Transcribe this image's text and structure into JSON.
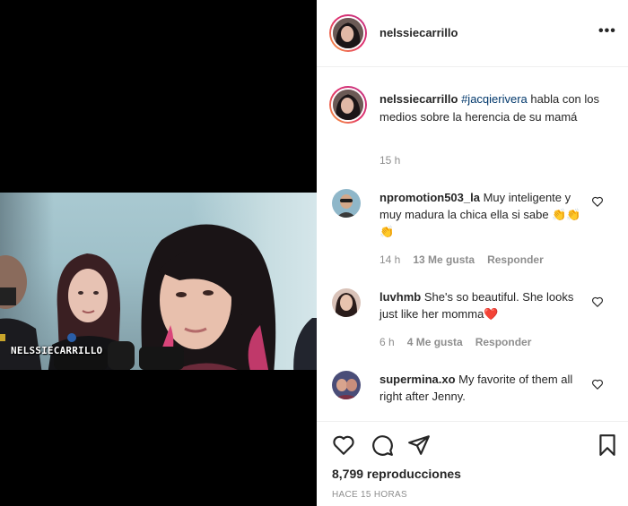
{
  "media": {
    "watermark": "NELSSIECARRILLO"
  },
  "header": {
    "username": "nelssiecarrillo",
    "more_icon": "more-horizontal-icon"
  },
  "caption": {
    "username": "nelssiecarrillo",
    "hashtag": "#jacqierivera",
    "text": " habla con los medios sobre la herencia de su mamá",
    "time": "15 h"
  },
  "comments": [
    {
      "username": "npromotion503_la",
      "text": " Muy inteligente y muy madura la chica ella si sabe 👏👏👏",
      "time": "14 h",
      "likes": "13 Me gusta",
      "reply": "Responder"
    },
    {
      "username": "luvhmb",
      "text": " She's so beautiful. She looks just like her momma❤️",
      "time": "6 h",
      "likes": "4 Me gusta",
      "reply": "Responder"
    },
    {
      "username": "supermina.xo",
      "text": " My favorite of them all right after Jenny.",
      "time": "",
      "likes": "",
      "reply": ""
    }
  ],
  "actions": {
    "icons": [
      "heart-icon",
      "comment-icon",
      "share-icon",
      "bookmark-icon"
    ],
    "views": "8,799 reproducciones",
    "posted": "HACE 15 HORAS"
  }
}
